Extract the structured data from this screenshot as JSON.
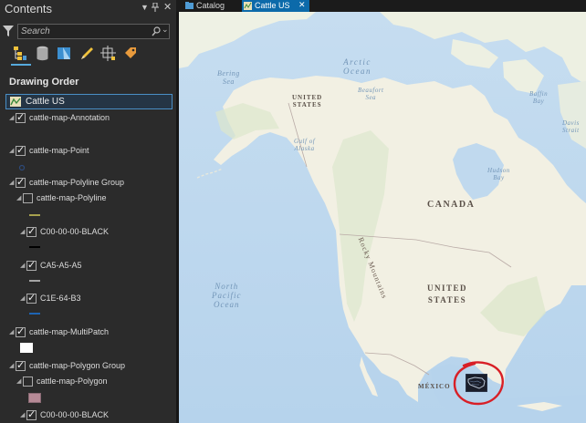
{
  "contents": {
    "title": "Contents",
    "search_placeholder": "Search",
    "drawing_order_label": "Drawing Order",
    "map_name": "Cattle US",
    "toolbar_icons": [
      "list-by-drawing-order-icon",
      "list-by-data-source-icon",
      "list-by-selection-icon",
      "list-by-editing-icon",
      "list-by-snapping-icon",
      "list-by-labeling-icon"
    ],
    "layers": [
      {
        "label": "cattle-map-Annotation",
        "checked": true
      },
      {
        "label": "cattle-map-Point",
        "checked": true
      },
      {
        "label": "cattle-map-Polyline Group",
        "checked": true
      },
      {
        "label": "cattle-map-Polyline",
        "checked": false
      },
      {
        "label": "C00-00-00-BLACK",
        "checked": true
      },
      {
        "label": "CA5-A5-A5",
        "checked": true
      },
      {
        "label": "C1E-64-B3",
        "checked": true
      },
      {
        "label": "cattle-map-MultiPatch",
        "checked": true
      },
      {
        "label": "cattle-map-Polygon Group",
        "checked": true
      },
      {
        "label": "cattle-map-Polygon",
        "checked": false
      },
      {
        "label": "C00-00-00-BLACK",
        "checked": true
      }
    ]
  },
  "tabs": [
    {
      "label": "Catalog",
      "active": false
    },
    {
      "label": "Cattle US",
      "active": true
    }
  ],
  "map": {
    "labels": {
      "bering_sea": [
        "Bering",
        "Sea"
      ],
      "arctic_ocean": [
        "Arctic",
        "Ocean"
      ],
      "beaufort_sea": [
        "Beaufort",
        "Sea"
      ],
      "baffin_bay": [
        "Baffin",
        "Bay"
      ],
      "davis_strait": [
        "Davis",
        "Strait"
      ],
      "gulf_of_alaska": [
        "Gulf of",
        "Alaska"
      ],
      "hudson_bay": [
        "Hudson",
        "Bay"
      ],
      "north_pacific_ocean": [
        "North",
        "Pacific",
        "Ocean"
      ],
      "united_states_alaska": [
        "UNITED",
        "STATES"
      ],
      "canada": "CANADA",
      "united_states": [
        "UNITED",
        "STATES"
      ],
      "mexico": "MÉXICO",
      "rocky_mountains": "Rocky Mountains"
    }
  },
  "colors": {
    "accent": "#0c6aaa",
    "selection_border": "#4a8fc6",
    "annotation_circle": "#d81f26",
    "polygon_symbol": "#b68a96",
    "polyline_symbol": "#a7a14e",
    "blue_line_symbol": "#1e64b3"
  }
}
